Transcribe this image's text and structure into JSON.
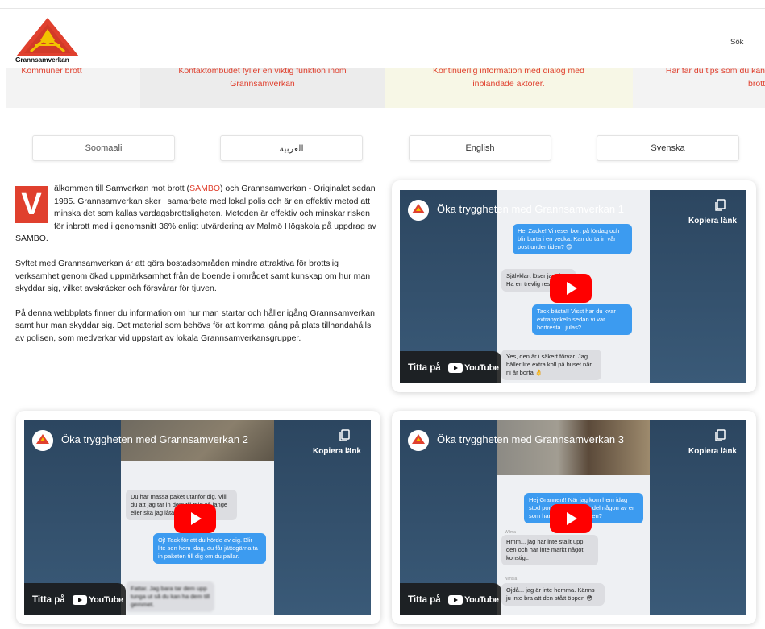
{
  "header": {
    "logo_text": "Grannsamverkan",
    "search_label": "Sök"
  },
  "strip": {
    "card1": "Kommuner brott",
    "card2_line1": "Kontaktombudet fyller en viktig funktion inom",
    "card2_line2": "Grannsamverkan",
    "card3_line1": "Kontinuerlig information med dialog med",
    "card3_line2": "inblandade aktörer.",
    "card4_line1": "Här får du tips som du kan",
    "card4_line2": "brott"
  },
  "languages": [
    "Soomaali",
    "العربية",
    "English",
    "Svenska"
  ],
  "intro": {
    "dropcap": "V",
    "p1_before": "älkommen till Samverkan mot brott (",
    "p1_link": "SAMBO",
    "p1_after": ") och Grannsamverkan - Originalet sedan 1985. Grannsamverkan sker i samarbete med lokal polis och är en effektiv metod att minska det som kallas vardagsbrottsligheten. Metoden är effektiv och minskar risken för inbrott med i genomsnitt 36% enligt utvärdering av Malmö Högskola på uppdrag av SAMBO.",
    "p2": "Syftet med Grannsamverkan är att göra bostadsområden mindre attraktiva för brottslig verksamhet genom ökad uppmärksamhet från de boende i området samt kunskap om hur man skyddar sig, vilket avskräcker och försvårar för tjuven.",
    "p3": "På denna webbplats finner du information om hur man startar och håller igång Grannsamverkan samt hur man skyddar sig. Det material som behövs för att komma igång på plats tillhandahålls av polisen, som medverkar vid uppstart av lokala Grannsamverkansgrupper."
  },
  "videos": [
    {
      "title": "Öka tryggheten med Grannsamverkan 1",
      "copy_label": "Kopiera länk",
      "watch_label": "Titta på",
      "youtube_label": "YouTube",
      "messages": [
        {
          "side": "blue",
          "text": "Hej Zacke! Vi reser bort på lördag och blir borta i en vecka. Kan du ta in vår post under tiden? 😎"
        },
        {
          "side": "gray",
          "text": "Självklart löser jag det! Ha en trevlig resa!"
        },
        {
          "side": "blue",
          "text": "Tack bästa!! Visst har du kvar extranyckeln sedan vi var bortresta i julas?"
        },
        {
          "side": "gray",
          "text": "Yes, den är i säkert förvar. Jag håller lite extra koll på huset när ni är borta 👌"
        }
      ]
    },
    {
      "title": "Öka tryggheten med Grannsamverkan 2",
      "copy_label": "Kopiera länk",
      "watch_label": "Titta på",
      "youtube_label": "YouTube",
      "messages": [
        {
          "side": "gray",
          "text": "Du har massa paket utanför dig. Vill du att jag tar in dem till mig så länge eller ska jag låta dem?"
        },
        {
          "side": "blue",
          "text": "Oj! Tack för att du hörde av dig. Blir lite sen hem idag, du får jättegärna ta in paketen till dig om du pallar."
        },
        {
          "side": "gray",
          "text": "Fattar. Jag bara tar dem upp tunga ut så du kan ha dem till gemmet."
        }
      ]
    },
    {
      "title": "Öka tryggheten med Grannsamverkan 3",
      "copy_label": "Kopiera länk",
      "watch_label": "Titta på",
      "youtube_label": "YouTube",
      "messages": [
        {
          "side": "blue",
          "text": "Hej Grannen!! När jag kom hem idag stod porten öppen. Har del någon av er som har glömt stänga den?"
        },
        {
          "side": "gray",
          "text": "Hmm... jag har inte ställt upp den och har inte märkt något konstigt."
        },
        {
          "side": "gray",
          "text": "Ojdå... jag är inte hemma. Känns ju inte bra att den stått öppen 😳"
        }
      ],
      "senders": [
        "Wilma",
        "Nimsia"
      ]
    }
  ],
  "colors": {
    "accent": "#e0402e",
    "bubble_blue": "#3c9bf0",
    "play_red": "#ff0000"
  }
}
